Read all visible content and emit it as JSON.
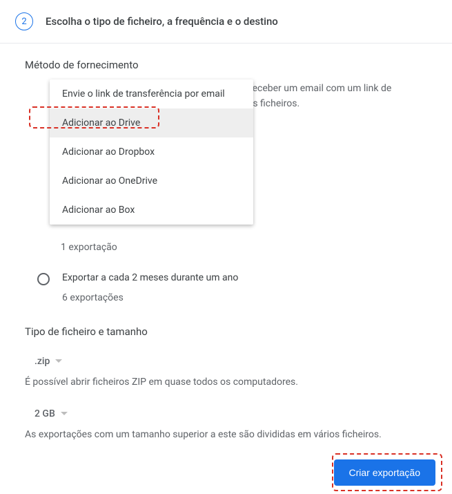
{
  "header": {
    "step_number": "2",
    "title": "Escolha o tipo de ficheiro, a frequência e o destino"
  },
  "section1": {
    "title": "Método de fornecimento",
    "dropdown": {
      "items": [
        "Envie o link de transferência por email",
        "Adicionar ao Drive",
        "Adicionar ao Dropbox",
        "Adicionar ao OneDrive",
        "Adicionar ao Box"
      ]
    },
    "hint_line1": "irá receber um email com um link de",
    "hint_line2": "rir os ficheiros."
  },
  "frequency": {
    "count1": "1 exportação",
    "option2_label": "Exportar a cada 2 meses durante um ano",
    "count2": "6 exportações"
  },
  "section2": {
    "title": "Tipo de ficheiro e tamanho",
    "filetype_value": ".zip",
    "filetype_desc": "É possível abrir ficheiros ZIP em quase todos os computadores.",
    "size_value": "2 GB",
    "size_desc": "As exportações com um tamanho superior a este são divididas em vários ficheiros."
  },
  "footer": {
    "button_label": "Criar exportação"
  }
}
